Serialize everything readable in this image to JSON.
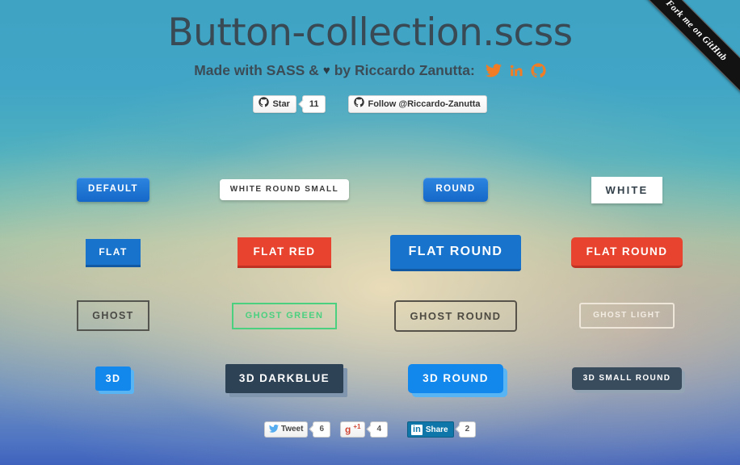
{
  "ribbon": {
    "label": "Fork me on GitHub"
  },
  "header": {
    "title": "Button-collection.scss",
    "subtitle_prefix": "Made with SASS &",
    "heart": "♥",
    "subtitle_suffix": "by Riccardo Zanutta:",
    "social": [
      {
        "name": "twitter-icon",
        "color": "#f07d26"
      },
      {
        "name": "linkedin-icon",
        "color": "#f07d26"
      },
      {
        "name": "github-icon",
        "color": "#f07d26"
      }
    ]
  },
  "github_widgets": {
    "star": {
      "icon": "github-icon",
      "label": "Star",
      "count": "11"
    },
    "follow": {
      "icon": "github-icon",
      "label": "Follow @Riccardo-Zanutta"
    }
  },
  "buttons": {
    "rows": [
      [
        {
          "label": "DEFAULT",
          "style": "b-default",
          "name": "button-default"
        },
        {
          "label": "WHITE ROUND SMALL",
          "style": "b-white-round-small",
          "name": "button-white-round-small"
        },
        {
          "label": "ROUND",
          "style": "b-round",
          "name": "button-round"
        },
        {
          "label": "WHITE",
          "style": "b-white",
          "name": "button-white"
        }
      ],
      [
        {
          "label": "FLAT",
          "style": "b-flat",
          "name": "button-flat"
        },
        {
          "label": "FLAT RED",
          "style": "b-flat-red",
          "name": "button-flat-red"
        },
        {
          "label": "FLAT ROUND",
          "style": "b-flat-round-blue",
          "name": "button-flat-round"
        },
        {
          "label": "FLAT ROUND",
          "style": "b-flat-round-red",
          "name": "button-flat-round-red"
        }
      ],
      [
        {
          "label": "GHOST",
          "style": "b-ghost",
          "name": "button-ghost"
        },
        {
          "label": "GHOST GREEN",
          "style": "b-ghost-green",
          "name": "button-ghost-green"
        },
        {
          "label": "GHOST ROUND",
          "style": "b-ghost-round",
          "name": "button-ghost-round"
        },
        {
          "label": "GHOST LIGHT",
          "style": "b-ghost-light",
          "name": "button-ghost-light"
        }
      ],
      [
        {
          "label": "3D",
          "style": "b-3d",
          "name": "button-3d"
        },
        {
          "label": "3D DARKBLUE",
          "style": "b-3d-darkblue",
          "name": "button-3d-darkblue"
        },
        {
          "label": "3D ROUND",
          "style": "b-3d-round",
          "name": "button-3d-round"
        },
        {
          "label": "3D SMALL ROUND",
          "style": "b-3d-small-round",
          "name": "button-3d-small-round"
        }
      ]
    ]
  },
  "share": {
    "tweet": {
      "label": "Tweet",
      "count": "6"
    },
    "gplus": {
      "label": "+1",
      "mark": "g",
      "count": "4"
    },
    "linkedin": {
      "mark": "in",
      "label": "Share",
      "count": "2"
    }
  },
  "colors": {
    "blue": "#1873cc",
    "red": "#e8432e",
    "green": "#4ad07f",
    "darkblue": "#2e4255",
    "accent_orange": "#f07d26",
    "title_text": "#3a4a55"
  }
}
